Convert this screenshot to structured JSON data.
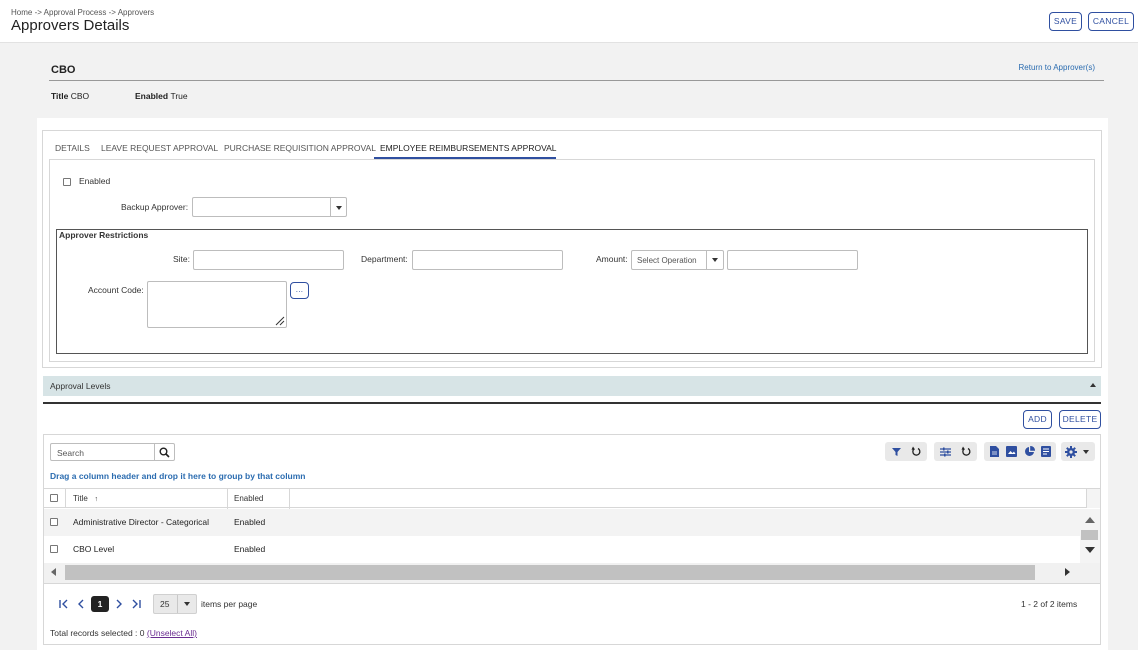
{
  "header": {
    "breadcrumb": "Home -> Approval Process -> Approvers",
    "title": "Approvers Details",
    "save_label": "SAVE",
    "cancel_label": "CANCEL"
  },
  "approver": {
    "name": "CBO",
    "return_link": "Return to Approver(s)",
    "title_label": "Title",
    "title_value": "CBO",
    "enabled_label": "Enabled",
    "enabled_value": "True"
  },
  "tabs": [
    {
      "label": "DETAILS"
    },
    {
      "label": "LEAVE REQUEST APPROVAL"
    },
    {
      "label": "PURCHASE REQUISITION APPROVAL"
    },
    {
      "label": "EMPLOYEE REIMBURSEMENTS APPROVAL",
      "active": true
    }
  ],
  "form": {
    "enabled_label": "Enabled",
    "enabled_checked": false,
    "backup_approver_label": "Backup Approver:",
    "backup_approver_value": "",
    "restrictions_legend": "Approver Restrictions",
    "site_label": "Site:",
    "department_label": "Department:",
    "amount_label": "Amount:",
    "amount_operation_placeholder": "Select Operation",
    "account_code_label": "Account Code:",
    "ellipsis_label": "..."
  },
  "approval_levels": {
    "title": "Approval Levels",
    "add_label": "ADD",
    "delete_label": "DELETE",
    "search_placeholder": "Search",
    "drag_tip": "Drag a column header and drop it here to group by that column",
    "columns": [
      "Title",
      "Enabled"
    ],
    "sort_indicator": "↑",
    "rows": [
      {
        "title": "Administrative Director - Categorical",
        "enabled": "Enabled"
      },
      {
        "title": "CBO Level",
        "enabled": "Enabled"
      }
    ],
    "pager": {
      "current_page": "1",
      "page_size": "25",
      "items_per_page": "items per page",
      "summary": "1 - 2 of 2 items"
    },
    "selected_text": "Total records selected : 0",
    "unselect_all": "(Unselect All)"
  },
  "colors": {
    "accent": "#2f4fa0",
    "link": "#2b6cb0",
    "accordion": "#d7e4e6"
  },
  "icons": [
    "search-icon",
    "filter-icon",
    "reset-icon",
    "columns-icon",
    "export-pdf-icon",
    "export-image-icon",
    "chart-icon",
    "report-icon",
    "gear-icon"
  ]
}
